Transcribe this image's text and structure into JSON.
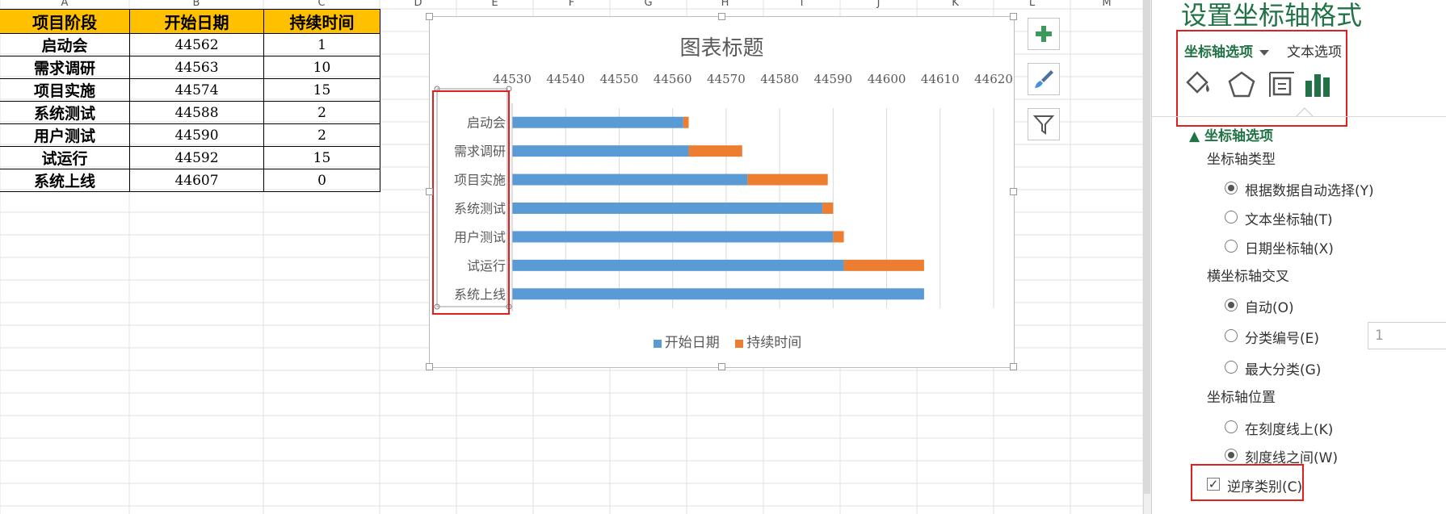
{
  "sheet": {
    "columns": [
      "A",
      "B",
      "C",
      "D",
      "E",
      "F",
      "G",
      "H",
      "I",
      "J",
      "K",
      "L",
      "M"
    ],
    "table": {
      "headers": [
        "项目阶段",
        "开始日期",
        "持续时间"
      ],
      "rows": [
        [
          "启动会",
          "44562",
          "1"
        ],
        [
          "需求调研",
          "44563",
          "10"
        ],
        [
          "项目实施",
          "44574",
          "15"
        ],
        [
          "系统测试",
          "44588",
          "2"
        ],
        [
          "用户测试",
          "44590",
          "2"
        ],
        [
          "试运行",
          "44592",
          "15"
        ],
        [
          "系统上线",
          "44607",
          "0"
        ]
      ]
    }
  },
  "chart_data": {
    "type": "bar",
    "orientation": "horizontal-stacked",
    "title": "图表标题",
    "categories": [
      "启动会",
      "需求调研",
      "项目实施",
      "系统测试",
      "用户测试",
      "试运行",
      "系统上线"
    ],
    "series": [
      {
        "name": "开始日期",
        "color": "#5b9bd5",
        "values": [
          44562,
          44563,
          44574,
          44588,
          44590,
          44592,
          44607
        ]
      },
      {
        "name": "持续时间",
        "color": "#ed7d31",
        "values": [
          1,
          10,
          15,
          2,
          2,
          15,
          0
        ]
      }
    ],
    "xlim": [
      44530,
      44620
    ],
    "xticks": [
      "44530",
      "44540",
      "44550",
      "44560",
      "44570",
      "44580",
      "44590",
      "44600",
      "44610",
      "44620"
    ],
    "x_axis_position": "top",
    "reverse_categories": true,
    "grid": true,
    "legend": "bottom"
  },
  "chart_tools": {
    "add_element": "plus-icon",
    "style": "brush-icon",
    "filter": "filter-icon"
  },
  "pane": {
    "title": "设置坐标轴格式",
    "tab_axis_options": "坐标轴选项",
    "tab_text_options": "文本选项",
    "icons": [
      "fill-line-icon",
      "effects-pentagon-icon",
      "size-properties-icon",
      "axis-options-bar-icon"
    ],
    "section_title": "坐标轴选项",
    "axis_type_label": "坐标轴类型",
    "axis_type_options": [
      "根据数据自动选择(Y)",
      "文本坐标轴(T)",
      "日期坐标轴(X)"
    ],
    "axis_type_selected": 0,
    "cross_label": "横坐标轴交叉",
    "cross_options": [
      "自动(O)",
      "分类编号(E)",
      "最大分类(G)"
    ],
    "cross_selected": 0,
    "category_number_value": "1",
    "position_label": "坐标轴位置",
    "position_options": [
      "在刻度线上(K)",
      "刻度线之间(W)"
    ],
    "position_selected": 1,
    "reverse_label": "逆序类别(C)",
    "reverse_checked": true
  },
  "colors": {
    "header_fill": "#ffc000",
    "excel_green": "#217346",
    "highlight_red": "#e02020"
  }
}
